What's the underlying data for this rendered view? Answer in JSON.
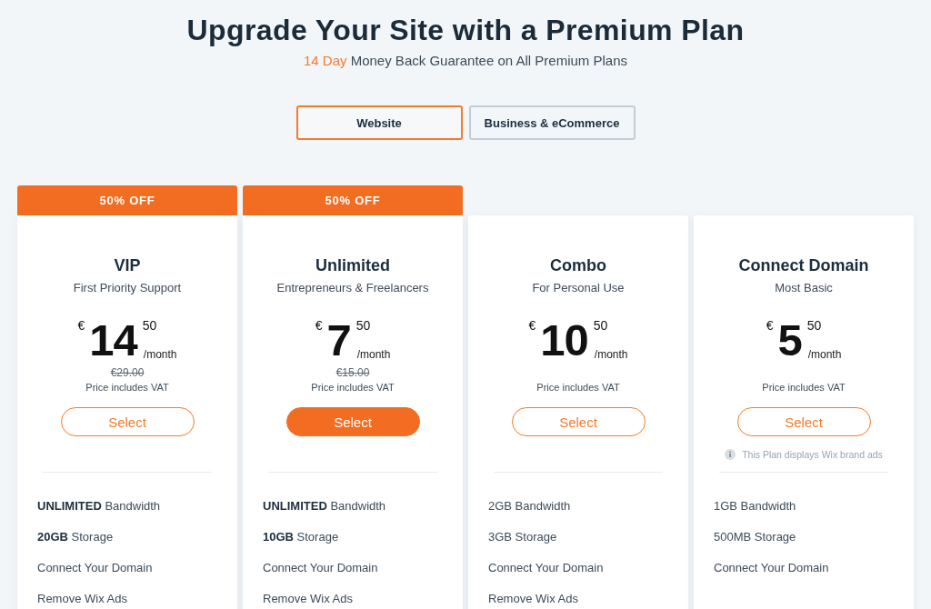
{
  "header": {
    "title": "Upgrade Your Site with a Premium Plan",
    "subtitle": {
      "highlight": "14 Day",
      "text": "Money Back Guarantee on All Premium Plans"
    }
  },
  "tabs": [
    {
      "label": "Website",
      "selected": true
    },
    {
      "label": "Business & eCommerce",
      "selected": false
    }
  ],
  "plans": [
    {
      "badge": "50% OFF",
      "name": "VIP",
      "tagline": "First Priority Support",
      "currency": "€",
      "amount": "14",
      "cents": "50",
      "period": "/month",
      "old_price": "€29.00",
      "vat_note": "Price includes VAT",
      "button": "Select",
      "featured": false,
      "features": [
        "**UNLIMITED** Bandwidth",
        "**20GB** Storage",
        "Connect Your Domain",
        "Remove Wix Ads"
      ]
    },
    {
      "badge": "50% OFF",
      "name": "Unlimited",
      "tagline": "Entrepreneurs & Freelancers",
      "currency": "€",
      "amount": "7",
      "cents": "50",
      "period": "/month",
      "old_price": "€15.00",
      "vat_note": "Price includes VAT",
      "button": "Select",
      "featured": true,
      "features": [
        "**UNLIMITED** Bandwidth",
        "**10GB** Storage",
        "Connect Your Domain",
        "Remove Wix Ads"
      ]
    },
    {
      "name": "Combo",
      "tagline": "For Personal Use",
      "currency": "€",
      "amount": "10",
      "cents": "50",
      "period": "/month",
      "vat_note": "Price includes VAT",
      "button": "Select",
      "featured": false,
      "features": [
        "2GB Bandwidth",
        "3GB Storage",
        "Connect Your Domain",
        "Remove Wix Ads"
      ]
    },
    {
      "name": "Connect Domain",
      "tagline": "Most Basic",
      "currency": "€",
      "amount": "5",
      "cents": "50",
      "period": "/month",
      "vat_note": "Price includes VAT",
      "button": "Select",
      "featured": false,
      "note": "This Plan displays Wix brand ads",
      "features": [
        "1GB Bandwidth",
        "500MB Storage",
        "Connect Your Domain"
      ]
    }
  ]
}
